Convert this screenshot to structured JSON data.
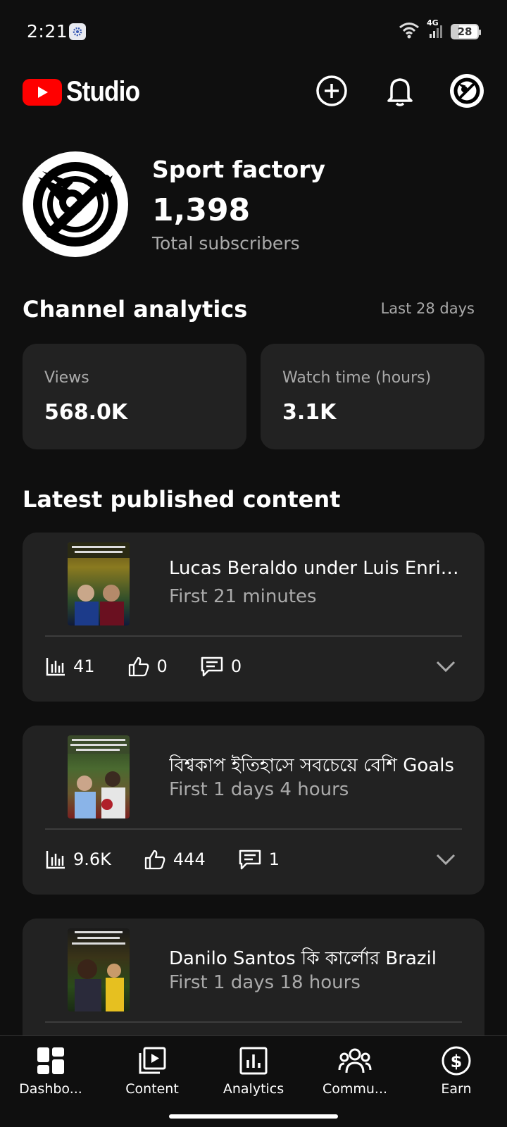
{
  "status_bar": {
    "time": "2:21",
    "network": "4G",
    "battery": "28"
  },
  "header": {
    "logo_text": "Studio"
  },
  "channel": {
    "name": "Sport factory",
    "subscribers": "1,398",
    "subscribers_label": "Total subscribers"
  },
  "analytics": {
    "title": "Channel analytics",
    "period": "Last 28 days",
    "metrics": [
      {
        "label": "Views",
        "value": "568.0K"
      },
      {
        "label": "Watch time (hours)",
        "value": "3.1K"
      }
    ]
  },
  "latest": {
    "title": "Latest published content",
    "items": [
      {
        "title": "Lucas Beraldo under Luis Enrique",
        "subtitle": "First 21 minutes",
        "views": "41",
        "likes": "0",
        "comments": "0"
      },
      {
        "title": "বিশ্বকাপ ইতিহাসে সবচেয়ে বেশি Goals",
        "subtitle": "First 1 days 4 hours",
        "views": "9.6K",
        "likes": "444",
        "comments": "1"
      },
      {
        "title": "Danilo Santos কি কার্লোর Brazil",
        "subtitle": "First 1 days 18 hours",
        "views": "",
        "likes": "",
        "comments": ""
      }
    ]
  },
  "nav": {
    "items": [
      {
        "label": "Dashbo..."
      },
      {
        "label": "Content"
      },
      {
        "label": "Analytics"
      },
      {
        "label": "Commu..."
      },
      {
        "label": "Earn"
      }
    ]
  },
  "colors": {
    "background": "#0f0f0f",
    "card": "#222222",
    "brand_red": "#ff0000",
    "secondary_text": "#aaaaaa"
  }
}
